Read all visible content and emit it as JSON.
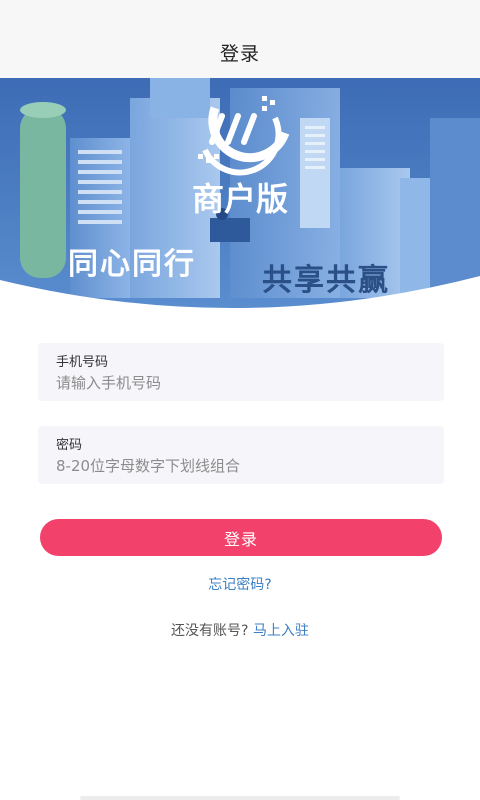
{
  "header": {
    "title": "登录"
  },
  "banner": {
    "edition_text": "商户版",
    "slogan_left": "同心同行",
    "slogan_right": "共享共赢"
  },
  "form": {
    "phone": {
      "label": "手机号码",
      "placeholder": "请输入手机号码",
      "value": ""
    },
    "password": {
      "label": "密码",
      "placeholder": "8-20位字母数字下划线组合",
      "value": ""
    },
    "submit_label": "登录"
  },
  "links": {
    "forgot_password": "忘记密码?",
    "register_prompt": "还没有账号?",
    "register_action": "马上入驻"
  },
  "colors": {
    "primary": "#f2416a",
    "link": "#3a7fc4",
    "banner_blue": "#3f6fb8"
  }
}
